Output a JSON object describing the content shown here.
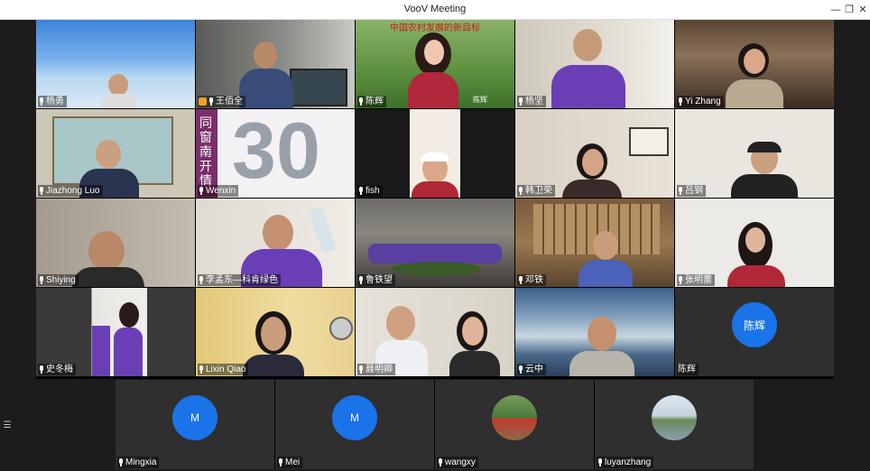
{
  "window": {
    "title": "VooV Meeting"
  },
  "grid": [
    {
      "name": "杨勇",
      "mic": true
    },
    {
      "name": "王佰全",
      "mic": true,
      "host": true
    },
    {
      "name": "陈辉",
      "mic": true,
      "banner": "中国农村发展的新目标",
      "overlay": "陈辉"
    },
    {
      "name": "杨坚",
      "mic": true
    },
    {
      "name": "Yi Zhang",
      "mic": true
    },
    {
      "name": "Jiazhong Luo",
      "mic": true
    },
    {
      "name": "Wenxin",
      "mic": true,
      "poster_text": "同窗南开情",
      "poster_number": "30"
    },
    {
      "name": "fish",
      "mic": true
    },
    {
      "name": "韩卫荣",
      "mic": true
    },
    {
      "name": "吕钢",
      "mic": true
    },
    {
      "name": "Shiying",
      "mic": true
    },
    {
      "name": "李孟东—科肯绿色",
      "mic": true
    },
    {
      "name": "鲁铁望",
      "mic": true
    },
    {
      "name": "邓铁",
      "mic": true
    },
    {
      "name": "张明蕾",
      "mic": true
    },
    {
      "name": "史冬梅",
      "mic": true
    },
    {
      "name": "Lixin Qiao",
      "mic": true
    },
    {
      "name": "聂明卿",
      "mic": true
    },
    {
      "name": "云中",
      "mic": true
    },
    {
      "name": "陈辉",
      "mic": false,
      "avatar": "陈辉"
    }
  ],
  "bottom": [
    {
      "name": "Mingxia",
      "mic": true,
      "avatar": "M"
    },
    {
      "name": "Mei",
      "mic": true,
      "avatar": "M"
    },
    {
      "name": "wangxy",
      "mic": true
    },
    {
      "name": "luyanzhang",
      "mic": true
    }
  ],
  "colors": {
    "avatar": "#1a73e8",
    "purple_shirt": "#6a3fb5"
  }
}
